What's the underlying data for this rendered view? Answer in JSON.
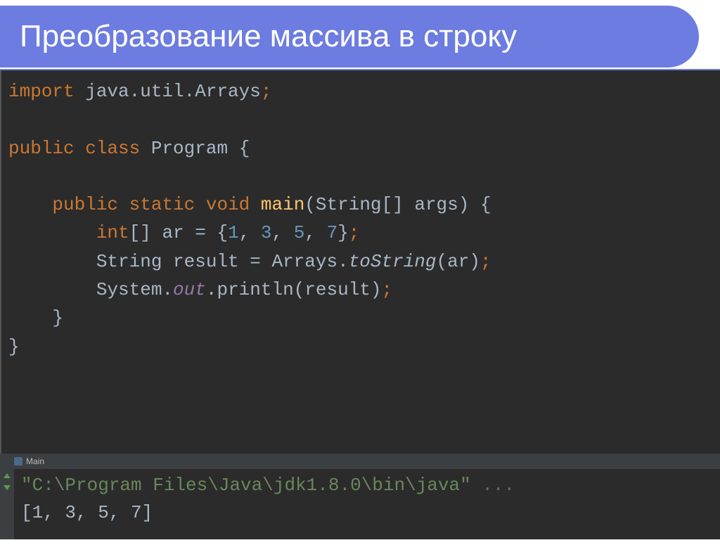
{
  "slide": {
    "title": "Преобразование массива в строку"
  },
  "code": {
    "line1_import": "import",
    "line1_pkg": " java.util.Arrays",
    "line1_semi": ";",
    "line3_public": "public",
    "line3_class": " class",
    "line3_name": " Program ",
    "line3_brace": "{",
    "line5_indent": "    ",
    "line5_public": "public",
    "line5_static": " static",
    "line5_void": " void",
    "line5_main": " main",
    "line5_paren": "(",
    "line5_string": "String",
    "line5_brackets": "[] args) {",
    "line6_indent": "        ",
    "line6_int": "int",
    "line6_decl": "[] ar = {",
    "line6_n1": "1",
    "line6_c1": ", ",
    "line6_n2": "3",
    "line6_c2": ", ",
    "line6_n3": "5",
    "line6_c3": ", ",
    "line6_n4": "7",
    "line6_end": "}",
    "line6_semi": ";",
    "line7_indent": "        ",
    "line7_text": "String result = Arrays.",
    "line7_method": "toString",
    "line7_args": "(ar)",
    "line7_semi": ";",
    "line8_indent": "        ",
    "line8_sys": "System.",
    "line8_out": "out",
    "line8_print": ".println(result)",
    "line8_semi": ";",
    "line9_indent": "    ",
    "line9_brace": "}",
    "line10_brace": "}"
  },
  "console": {
    "tab_label": "Main",
    "path_quote1": "\"",
    "path": "C:\\Program Files\\Java\\jdk1.8.0\\bin\\java",
    "path_quote2": "\"",
    "path_dots": " ...",
    "result": "[1, 3, 5, 7]"
  }
}
